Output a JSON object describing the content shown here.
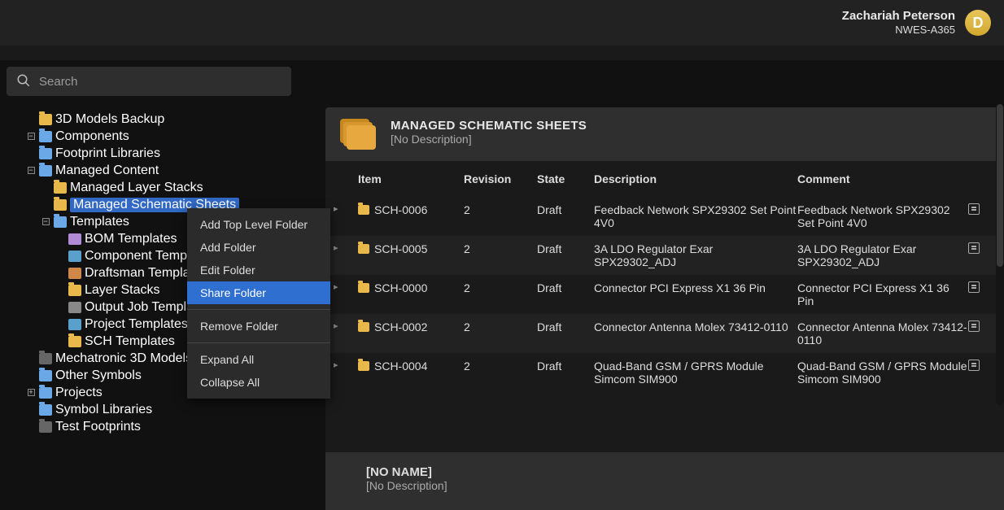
{
  "user": {
    "name": "Zachariah Peterson",
    "org": "NWES-A365",
    "initial": "D"
  },
  "search": {
    "placeholder": "Search"
  },
  "tree": {
    "items": [
      {
        "label": "3D Models Backup",
        "icon": "folder-yellow",
        "indent": 1,
        "exp": ""
      },
      {
        "label": "Components",
        "icon": "folder-blue",
        "indent": 1,
        "exp": "minus"
      },
      {
        "label": "Footprint Libraries",
        "icon": "folder-blue",
        "indent": 1,
        "exp": ""
      },
      {
        "label": "Managed Content",
        "icon": "folder-blue",
        "indent": 1,
        "exp": "minus"
      },
      {
        "label": "Managed Layer Stacks",
        "icon": "folder-yellow",
        "indent": 2,
        "exp": ""
      },
      {
        "label": "Managed Schematic Sheets",
        "icon": "folder-yellow",
        "indent": 2,
        "exp": "",
        "selected": true
      },
      {
        "label": "Templates",
        "icon": "folder-blue",
        "indent": 2,
        "exp": "minus"
      },
      {
        "label": "BOM Templates",
        "icon": "box",
        "indent": 3,
        "exp": ""
      },
      {
        "label": "Component Templates",
        "icon": "box2",
        "indent": 3,
        "exp": ""
      },
      {
        "label": "Draftsman Templates",
        "icon": "box3",
        "indent": 3,
        "exp": ""
      },
      {
        "label": "Layer Stacks",
        "icon": "folder-yellow",
        "indent": 3,
        "exp": ""
      },
      {
        "label": "Output Job Templates",
        "icon": "box4",
        "indent": 3,
        "exp": ""
      },
      {
        "label": "Project Templates",
        "icon": "box2",
        "indent": 3,
        "exp": ""
      },
      {
        "label": "SCH Templates",
        "icon": "folder-yellow",
        "indent": 3,
        "exp": ""
      },
      {
        "label": "Mechatronic 3D Models",
        "icon": "folder-grey",
        "indent": 1,
        "exp": ""
      },
      {
        "label": "Other Symbols",
        "icon": "folder-blue",
        "indent": 1,
        "exp": ""
      },
      {
        "label": "Projects",
        "icon": "folder-blue",
        "indent": 1,
        "exp": "plus"
      },
      {
        "label": "Symbol Libraries",
        "icon": "folder-blue",
        "indent": 1,
        "exp": ""
      },
      {
        "label": "Test Footprints",
        "icon": "folder-grey",
        "indent": 1,
        "exp": ""
      }
    ]
  },
  "contextMenu": {
    "items": [
      {
        "label": "Add Top Level Folder"
      },
      {
        "label": "Add Folder"
      },
      {
        "label": "Edit Folder"
      },
      {
        "label": "Share Folder",
        "highlight": true
      },
      {
        "sep": true
      },
      {
        "label": "Remove Folder"
      },
      {
        "sep": true
      },
      {
        "label": "Expand All"
      },
      {
        "label": "Collapse All"
      }
    ]
  },
  "panel": {
    "title": "MANAGED SCHEMATIC SHEETS",
    "subtitle": "[No Description]",
    "columns": {
      "item": "Item",
      "revision": "Revision",
      "state": "State",
      "description": "Description",
      "comment": "Comment"
    },
    "rows": [
      {
        "item": "SCH-0006",
        "revision": "2",
        "state": "Draft",
        "description": "Feedback Network SPX29302 Set Point 4V0",
        "comment": "Feedback Network SPX29302 Set Point 4V0"
      },
      {
        "item": "SCH-0005",
        "revision": "2",
        "state": "Draft",
        "description": "3A LDO Regulator Exar SPX29302_ADJ",
        "comment": "3A LDO Regulator Exar SPX29302_ADJ"
      },
      {
        "item": "SCH-0000",
        "revision": "2",
        "state": "Draft",
        "description": "Connector PCI Express X1 36 Pin",
        "comment": "Connector PCI Express X1 36 Pin"
      },
      {
        "item": "SCH-0002",
        "revision": "2",
        "state": "Draft",
        "description": "Connector Antenna Molex 73412-0110",
        "comment": "Connector Antenna Molex 73412-0110"
      },
      {
        "item": "SCH-0004",
        "revision": "2",
        "state": "Draft",
        "description": "Quad-Band GSM / GPRS Module Simcom SIM900",
        "comment": "Quad-Band GSM / GPRS Module Simcom SIM900"
      }
    ],
    "footer": {
      "title": "[NO NAME]",
      "subtitle": "[No Description]"
    }
  }
}
